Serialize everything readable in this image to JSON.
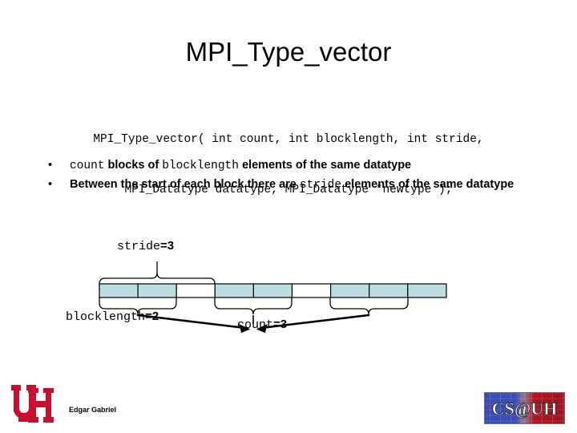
{
  "slide": {
    "title": "MPI_Type_vector",
    "signature": {
      "line1": "MPI_Type_vector( int count, int blocklength, int stride,",
      "line2": "MPI_Datatype datatype, MPI_Datatype *newtype );"
    },
    "bullets": [
      {
        "marker": "•",
        "parts": [
          {
            "text": "count",
            "style": "code"
          },
          {
            "text": " blocks of ",
            "style": "bold"
          },
          {
            "text": "blocklength",
            "style": "code"
          },
          {
            "text": " elements of the same datatype",
            "style": "bold"
          }
        ]
      },
      {
        "marker": "•",
        "parts": [
          {
            "text": "Between the start of each block there are ",
            "style": "bold"
          },
          {
            "text": "stride",
            "style": "code"
          },
          {
            "text": " elements of the same datatype",
            "style": "bold"
          }
        ]
      }
    ],
    "diagram": {
      "labels": {
        "stride": {
          "name": "stride",
          "value": "=3"
        },
        "blocklength": {
          "name": "blocklength",
          "value": "=2"
        },
        "count": {
          "name": "count",
          "value": "=3"
        }
      },
      "bar": {
        "cell_count": 9,
        "filled_color": "#bcdee3",
        "empty_color": "#ffffff",
        "border_color": "#000000",
        "cells": [
          "filled",
          "filled",
          "empty",
          "filled",
          "filled",
          "empty",
          "filled",
          "filled",
          "filled"
        ]
      },
      "stride_brace_cells": 3,
      "block_brace_cells": 2,
      "block_brace_positions": [
        0,
        3,
        6
      ]
    },
    "footer": {
      "author": "Edgar Gabriel",
      "uh_logo_alt": "UH",
      "csuh_logo_alt": "CS@UH",
      "uh_color": "#c8102e",
      "csuh_blue": "#2a3b9e",
      "csuh_red": "#b01622"
    }
  }
}
